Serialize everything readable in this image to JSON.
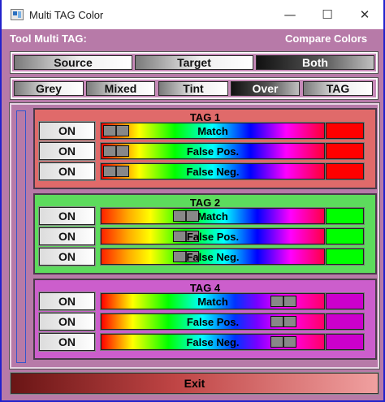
{
  "window": {
    "title": "Multi TAG Color",
    "minimize": "—",
    "maximize": "☐",
    "close": "✕"
  },
  "header": {
    "left": "Tool Multi TAG:",
    "right": "Compare Colors"
  },
  "mode_tabs": [
    {
      "label": "Source",
      "active": false
    },
    {
      "label": "Target",
      "active": false
    },
    {
      "label": "Both",
      "active": true
    }
  ],
  "view_tabs": [
    {
      "label": "Grey",
      "active": false
    },
    {
      "label": "Mixed",
      "active": false
    },
    {
      "label": "Tint",
      "active": false
    },
    {
      "label": "Over",
      "active": true
    },
    {
      "label": "TAG",
      "active": false
    }
  ],
  "tags": [
    {
      "title": "TAG 1",
      "panel_color": "#e06a6a",
      "swatch_color": "#ff0000",
      "hue_start": "red",
      "rows": [
        {
          "on_label": "ON",
          "label": "Match",
          "slider_value": 0.0
        },
        {
          "on_label": "ON",
          "label": "False Pos.",
          "slider_value": 0.0
        },
        {
          "on_label": "ON",
          "label": "False Neg.",
          "slider_value": 0.0
        }
      ]
    },
    {
      "title": "TAG 2",
      "panel_color": "#5ddb5d",
      "swatch_color": "#00ff00",
      "hue_start": "green",
      "rows": [
        {
          "on_label": "ON",
          "label": "Match",
          "slider_value": 0.36
        },
        {
          "on_label": "ON",
          "label": "False Pos.",
          "slider_value": 0.36
        },
        {
          "on_label": "ON",
          "label": "False Neg.",
          "slider_value": 0.36
        }
      ]
    },
    {
      "title": "TAG 4",
      "panel_color": "#cc5ecc",
      "swatch_color": "#cc00cc",
      "hue_start": "magenta",
      "rows": [
        {
          "on_label": "ON",
          "label": "Match",
          "slider_value": 0.86
        },
        {
          "on_label": "ON",
          "label": "False Pos.",
          "slider_value": 0.86
        },
        {
          "on_label": "ON",
          "label": "False Neg.",
          "slider_value": 0.86
        }
      ]
    }
  ],
  "exit_label": "Exit"
}
